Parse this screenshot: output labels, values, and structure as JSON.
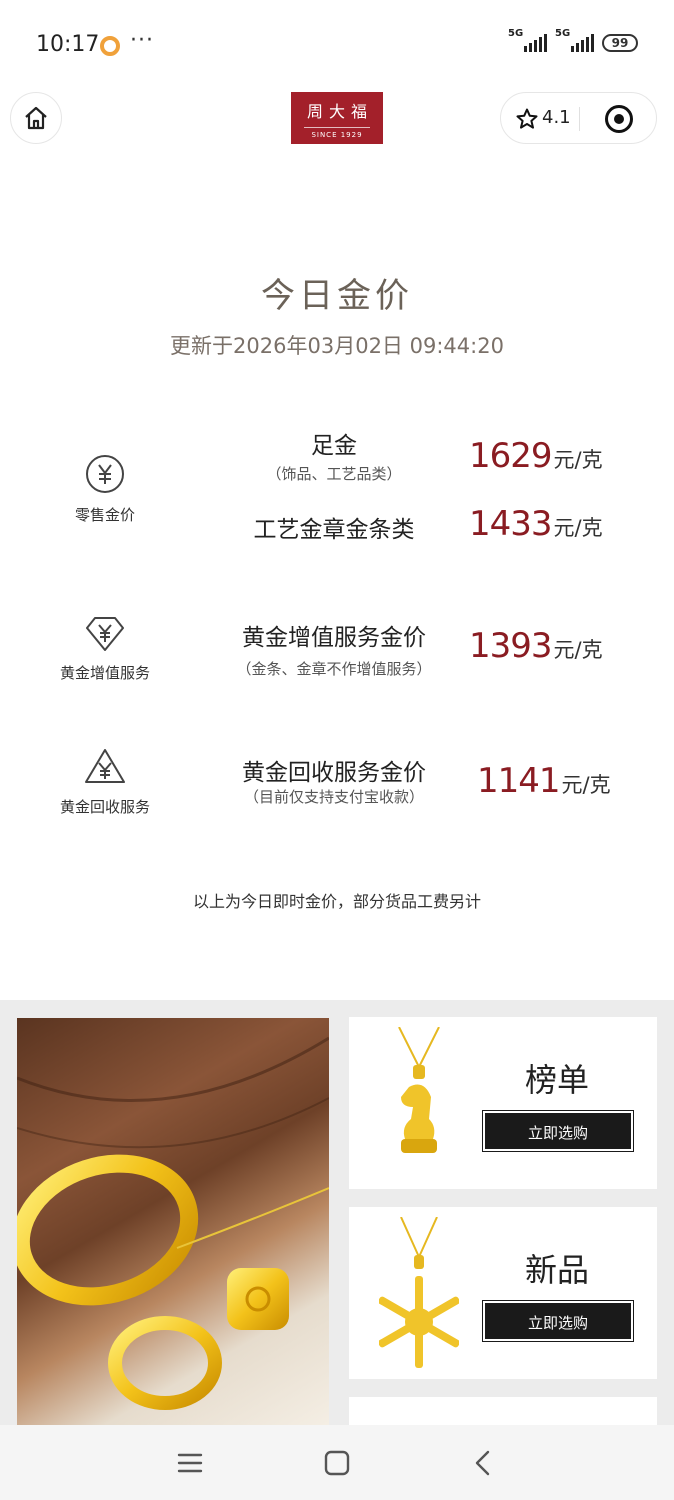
{
  "status_bar": {
    "time": "10:17",
    "more": "···",
    "signal_1": "5G",
    "signal_2": "5G",
    "battery": "99"
  },
  "header": {
    "brand_name": "周大福",
    "brand_since": "SINCE 1929",
    "rating": "4.1"
  },
  "title": "今日金价",
  "updated": "更新于2026年03月02日 09:44:20",
  "groups": [
    {
      "label": "零售金价",
      "icon": "yuan-circle-icon",
      "rows": [
        {
          "name": "足金",
          "note": "（饰品、工艺品类）",
          "price": "1629",
          "unit": "元/克"
        },
        {
          "name": "工艺金章金条类",
          "note": "",
          "price": "1433",
          "unit": "元/克"
        }
      ]
    },
    {
      "label": "黄金增值服务",
      "icon": "yuan-diamond-icon",
      "rows": [
        {
          "name": "黄金增值服务金价",
          "note": "（金条、金章不作增值服务）",
          "price": "1393",
          "unit": "元/克"
        }
      ]
    },
    {
      "label": "黄金回收服务",
      "icon": "yuan-recycle-icon",
      "rows": [
        {
          "name": "黄金回收服务金价",
          "note": "（目前仅支持支付宝收款）",
          "price": "1141",
          "unit": "元/克"
        }
      ]
    }
  ],
  "disclaimer": "以上为今日即时金价，部分货品工费另计",
  "promos": [
    {
      "title": "榜单",
      "button": "立即选购"
    },
    {
      "title": "新品",
      "button": "立即选购"
    }
  ],
  "colors": {
    "brand_red": "#a3202a",
    "price_red": "#8a1c22",
    "title_gray": "#6b6258"
  }
}
